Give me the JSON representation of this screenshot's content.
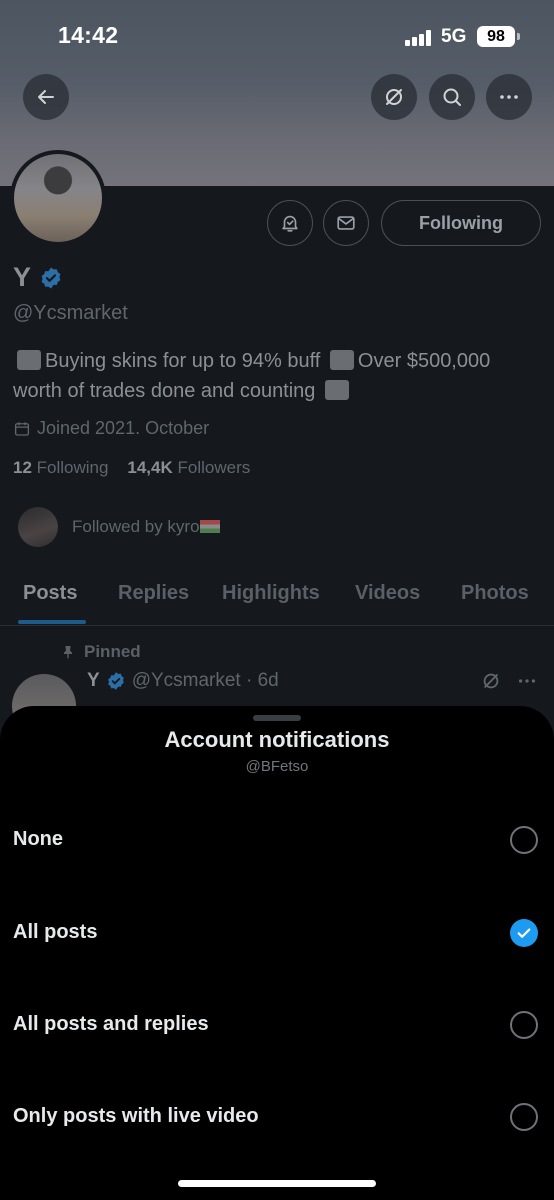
{
  "status_bar": {
    "time": "14:42",
    "network": "5G",
    "battery": "98"
  },
  "profile": {
    "name": "Y",
    "handle": "@Ycsmarket",
    "bio_part1": "Buying skins for up to 94% buff",
    "bio_part2": "Over $500,000 worth of trades done and counting",
    "joined": "Joined 2021. October",
    "following_count": "12",
    "following_label": "Following",
    "followers_count": "14,4K",
    "followers_label": "Followers",
    "followed_by": "Followed by kyro",
    "following_button": "Following"
  },
  "tabs": [
    {
      "label": "Posts"
    },
    {
      "label": "Replies"
    },
    {
      "label": "Highlights"
    },
    {
      "label": "Videos"
    },
    {
      "label": "Photos"
    }
  ],
  "pinned_post": {
    "pinned_label": "Pinned",
    "name": "Y",
    "handle_time": "@Ycsmarket · 6d"
  },
  "sheet": {
    "title": "Account notifications",
    "subtitle": "@BFetso",
    "options": [
      {
        "label": "None",
        "checked": false
      },
      {
        "label": "All posts",
        "checked": true
      },
      {
        "label": "All posts and replies",
        "checked": false
      },
      {
        "label": "Only posts with live video",
        "checked": false
      }
    ]
  },
  "colors": {
    "accent": "#1d9bf0",
    "sheet_bg": "#000000",
    "profile_bg": "#15181c"
  },
  "icons": [
    "back-arrow-icon",
    "grok-icon",
    "search-icon",
    "more-icon",
    "bell-icon",
    "mail-icon",
    "verified-icon",
    "calendar-icon",
    "pin-icon",
    "check-icon"
  ]
}
